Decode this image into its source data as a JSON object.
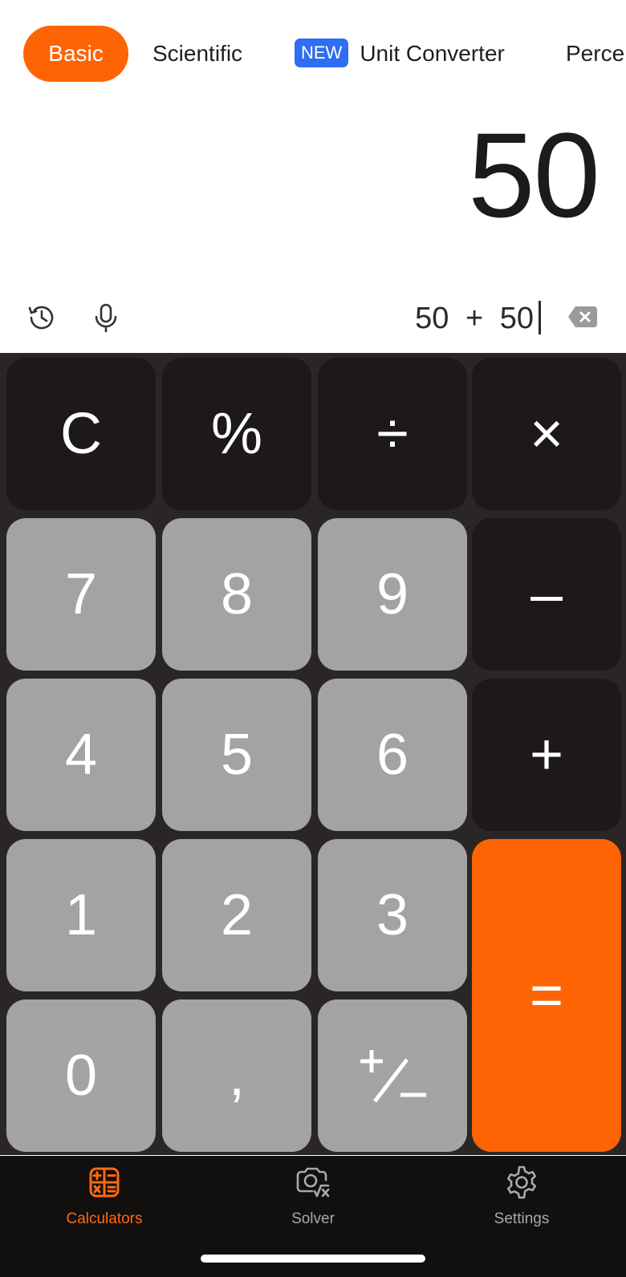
{
  "tabs": {
    "basic": "Basic",
    "scientific": "Scientific",
    "new_badge": "NEW",
    "unit_converter": "Unit Converter",
    "percentage": "Perce"
  },
  "display": {
    "result": "50",
    "expression_left": "50",
    "expression_op": "+",
    "expression_right": "50"
  },
  "icons": {
    "history": "history-icon",
    "mic": "microphone-icon",
    "backspace": "backspace-icon"
  },
  "keys": {
    "clear": "C",
    "percent": "%",
    "divide": "÷",
    "multiply": "×",
    "seven": "7",
    "eight": "8",
    "nine": "9",
    "minus": "–",
    "four": "4",
    "five": "5",
    "six": "6",
    "plus": "+",
    "one": "1",
    "two": "2",
    "three": "3",
    "equals": "=",
    "zero": "0",
    "comma": ","
  },
  "nav": {
    "calculators": "Calculators",
    "solver": "Solver",
    "settings": "Settings"
  },
  "colors": {
    "accent": "#ff6404",
    "new_badge": "#2f6df2",
    "key_dark": "#1c1918",
    "key_light": "#a3a3a3",
    "keypad_bg": "#2a2626",
    "nav_bg": "#120f0f"
  }
}
